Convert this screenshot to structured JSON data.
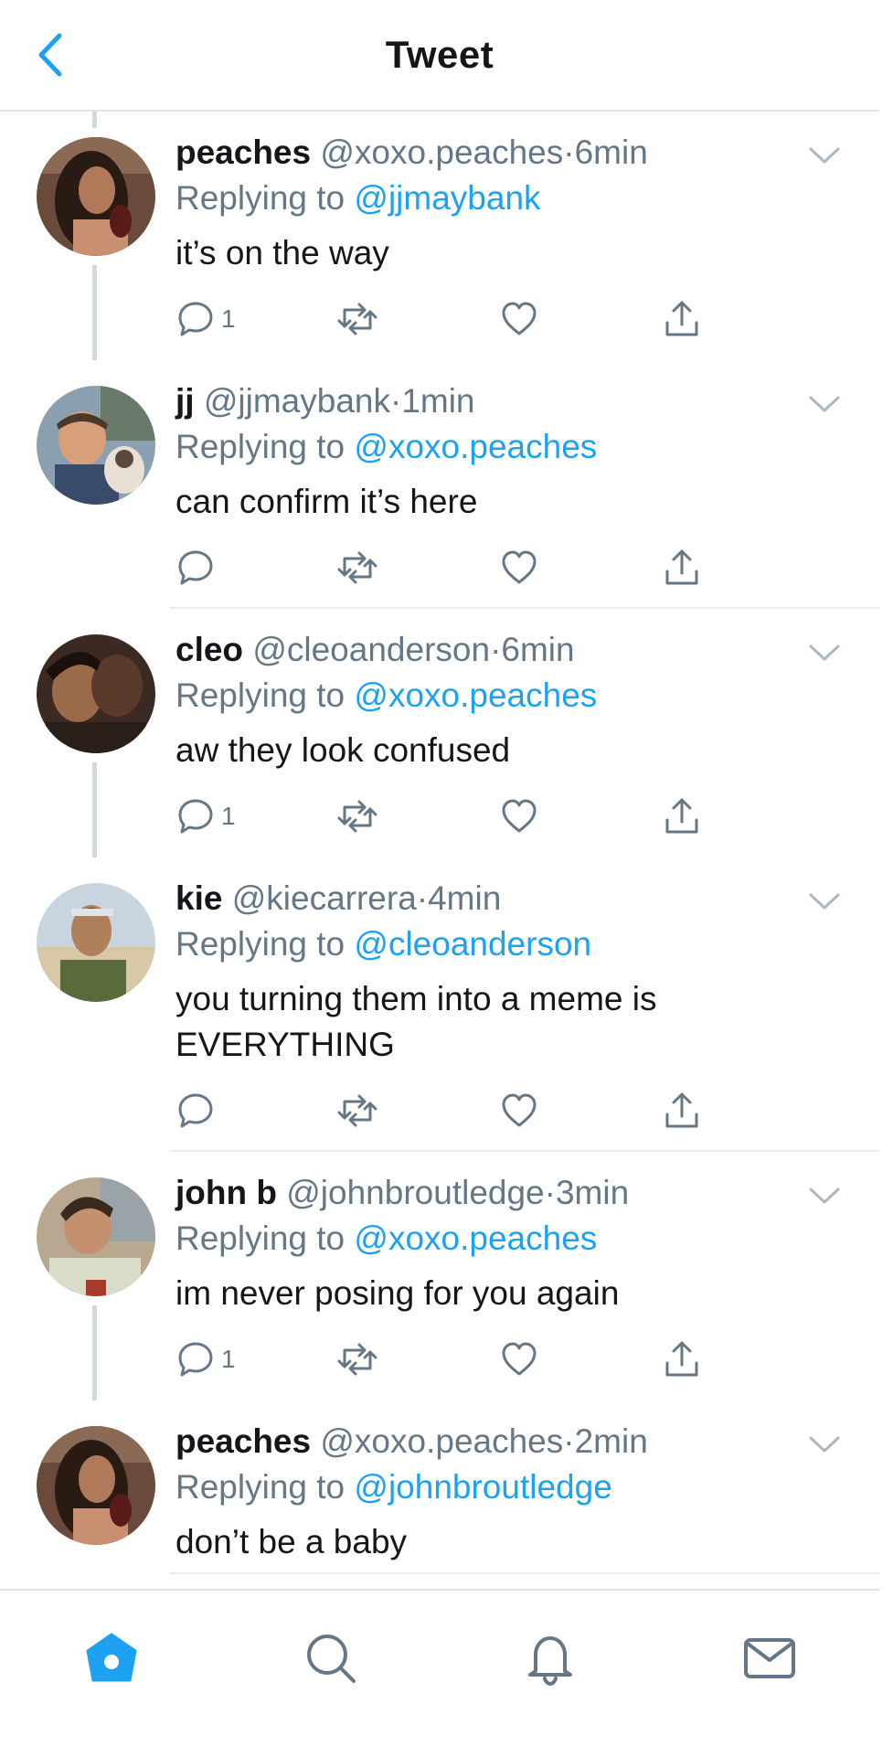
{
  "header": {
    "title": "Tweet",
    "back_icon": "chevron-left-icon"
  },
  "colors": {
    "accent": "#1da1f2",
    "secondary_text": "#657786",
    "primary_text": "#14171a",
    "thread_line": "#cfd9de"
  },
  "tweets": [
    {
      "name": "peaches",
      "handle": "@xoxo.peaches",
      "sep": "·",
      "time": "6min",
      "replying_label": "Replying to",
      "replying_to": "@jjmaybank",
      "text": "it’s on the way",
      "reply_count": "1"
    },
    {
      "name": "jj",
      "handle": "@jjmaybank",
      "sep": "·",
      "time": "1min",
      "replying_label": "Replying to",
      "replying_to": "@xoxo.peaches",
      "text": "can confirm it’s here",
      "reply_count": ""
    },
    {
      "name": "cleo",
      "handle": "@cleoanderson",
      "sep": "·",
      "time": "6min",
      "replying_label": "Replying to",
      "replying_to": "@xoxo.peaches",
      "text": "aw they look confused",
      "reply_count": "1"
    },
    {
      "name": "kie",
      "handle": "@kiecarrera",
      "sep": "·",
      "time": "4min",
      "replying_label": "Replying to",
      "replying_to": "@cleoanderson",
      "text": "you turning them into a meme is EVERYTHING",
      "reply_count": ""
    },
    {
      "name": "john b",
      "handle": "@johnbroutledge",
      "sep": "·",
      "time": "3min",
      "replying_label": "Replying to",
      "replying_to": "@xoxo.peaches",
      "text": "im never posing for you again",
      "reply_count": "1"
    },
    {
      "name": "peaches",
      "handle": "@xoxo.peaches",
      "sep": "·",
      "time": "2min",
      "replying_label": "Replying to",
      "replying_to": "@johnbroutledge",
      "text": "don’t be a baby",
      "reply_count": ""
    }
  ],
  "tabbar": {
    "items": [
      "home-icon",
      "search-icon",
      "notifications-bell-icon",
      "messages-envelope-icon"
    ],
    "active": "home-icon"
  }
}
